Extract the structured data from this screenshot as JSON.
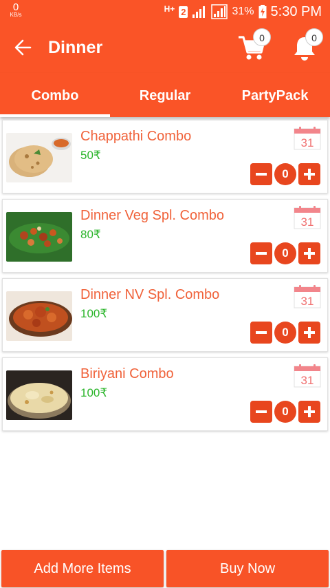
{
  "status_bar": {
    "net_speed": "0",
    "net_unit": "KB/s",
    "network_type": "H+",
    "sim_slot": "2",
    "battery_percent": "31%",
    "time": "5:30 PM"
  },
  "app_bar": {
    "title": "Dinner",
    "cart_count": "0",
    "notification_count": "0"
  },
  "tabs": [
    {
      "label": "Combo",
      "selected": true
    },
    {
      "label": "Regular",
      "selected": false
    },
    {
      "label": "PartyPack",
      "selected": false
    }
  ],
  "items": [
    {
      "name": "Chappathi Combo",
      "price": "50₹",
      "quantity": "0",
      "calendar_day": "31"
    },
    {
      "name": "Dinner Veg Spl. Combo",
      "price": "80₹",
      "quantity": "0",
      "calendar_day": "31"
    },
    {
      "name": "Dinner NV Spl. Combo",
      "price": "100₹",
      "quantity": "0",
      "calendar_day": "31"
    },
    {
      "name": "Biriyani Combo",
      "price": "100₹",
      "quantity": "0",
      "calendar_day": "31"
    }
  ],
  "footer": {
    "add_more_label": "Add More Items",
    "buy_now_label": "Buy Now"
  },
  "colors": {
    "primary": "#fa5427",
    "stepper": "#e8461e",
    "item_name": "#f0623a",
    "price": "#2bb52b"
  }
}
